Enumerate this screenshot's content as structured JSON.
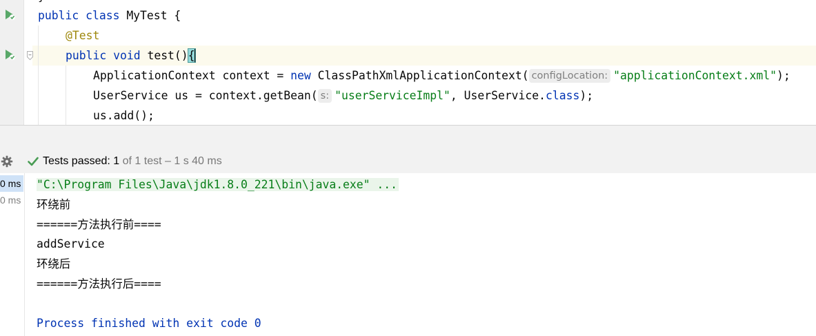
{
  "editor": {
    "top_stub": "}",
    "lines": [
      {
        "kind": "class",
        "kw1": "public",
        "kw2": "class",
        "name": "MyTest {"
      },
      {
        "kind": "annotation",
        "text": "@Test"
      },
      {
        "kind": "method",
        "kw1": "public",
        "kw2": "void",
        "name": "test()",
        "brace": "{"
      },
      {
        "kind": "stmt1",
        "a": "ApplicationContext context = ",
        "kw": "new",
        "b": " ClassPathXmlApplicationContext(",
        "hint": "configLocation:",
        "str": "\"applicationContext.xml\"",
        "c": ");"
      },
      {
        "kind": "stmt2",
        "a": "UserService us = context.getBean(",
        "hint": "s:",
        "str": "\"userServiceImpl\"",
        "b": ", UserService.",
        "kw": "class",
        "c": ");"
      },
      {
        "kind": "stmt3",
        "text": "us.add();"
      }
    ],
    "icons": [
      "run-test-icon",
      "run-test-icon",
      "fold-marker-icon"
    ]
  },
  "test_bar": {
    "status_label": "Tests passed:",
    "status_count": "1",
    "status_rest": "of 1 test – 1 s 40 ms",
    "icons": [
      "settings-gear-icon",
      "check-pass-icon"
    ],
    "colors": {
      "pass": "#499c54"
    }
  },
  "console": {
    "times": [
      "0 ms",
      "0 ms"
    ],
    "command": "\"C:\\Program Files\\Java\\jdk1.8.0_221\\bin\\java.exe\" ...",
    "output": [
      "环绕前",
      "======方法执行前====",
      "addService",
      "环绕后",
      "======方法执行后===="
    ],
    "exit": "Process finished with exit code 0"
  }
}
